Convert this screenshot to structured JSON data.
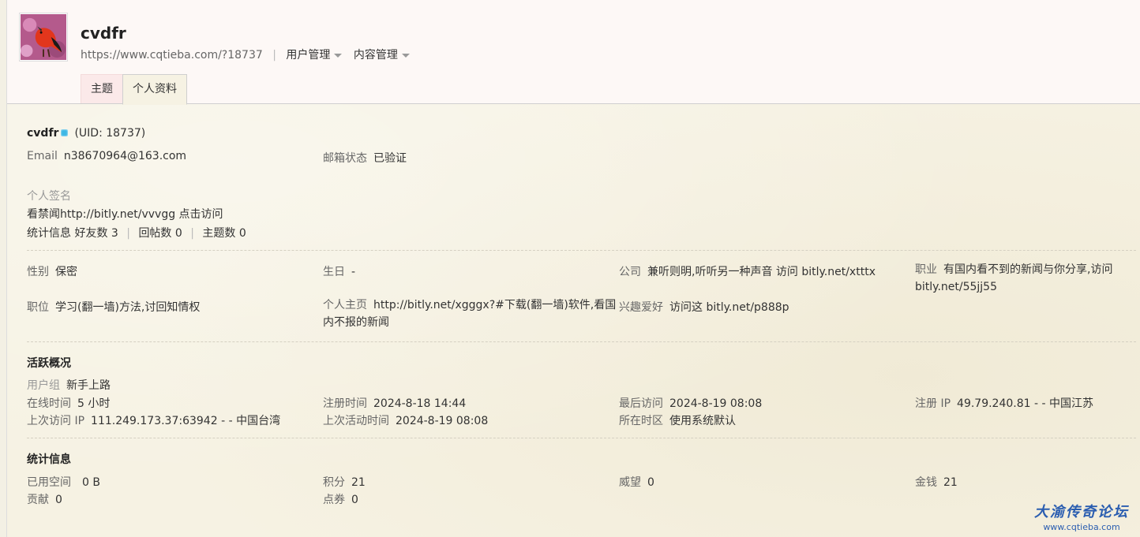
{
  "header": {
    "site_name": "cvdfr",
    "url": "https://www.cqtieba.com/?18737",
    "menus": [
      "用户管理",
      "内容管理"
    ],
    "tabs": [
      "主题",
      "个人资料"
    ]
  },
  "profile": {
    "username": "cvdfr",
    "uid": "(UID: 18737)",
    "email_label": "Email",
    "email": "n38670964@163.com",
    "email_status_label": "邮箱状态",
    "email_status": "已验证",
    "signature_label": "个人签名",
    "signature": "看禁闻http://bitly.net/vvvgg 点击访问",
    "stats_label": "统计信息",
    "stats": [
      "好友数 3",
      "回帖数 0",
      "主题数 0"
    ]
  },
  "details": {
    "gender_label": "性别",
    "gender": "保密",
    "birthday_label": "生日",
    "birthday": "-",
    "company_label": "公司",
    "company": "兼听则明,听听另一种声音 访问 bitly.net/xtttx",
    "occupation_label": "职业",
    "occupation": "有国内看不到的新闻与你分享,访问 bitly.net/55jj55",
    "position_label": "职位",
    "position": "学习(翻一墙)方法,讨回知情权",
    "homepage_label": "个人主页",
    "homepage": "http://bitly.net/xgggx?#下载(翻一墙)软件,看国内不报的新闻",
    "hobby_label": "兴趣爱好",
    "hobby": "访问这 bitly.net/p888p"
  },
  "activity": {
    "title": "活跃概况",
    "group_label": "用户组",
    "group": "新手上路",
    "online_label": "在线时间",
    "online": "5 小时",
    "reg_time_label": "注册时间",
    "reg_time": "2024-8-18 14:44",
    "last_visit_label": "最后访问",
    "last_visit": "2024-8-19 08:08",
    "reg_ip_label": "注册 IP",
    "reg_ip": "49.79.240.81 - - 中国江苏",
    "prev_ip_label": "上次访问 IP",
    "prev_ip": "111.249.173.37:63942 - - 中国台湾",
    "last_active_label": "上次活动时间",
    "last_active": "2024-8-19 08:08",
    "timezone_label": "所在时区",
    "timezone": "使用系统默认"
  },
  "statistics": {
    "title": "统计信息",
    "space_label": "已用空间",
    "space": "0 B",
    "points_label": "积分",
    "points": "21",
    "prestige_label": "威望",
    "prestige": "0",
    "money_label": "金钱",
    "money": "21",
    "contrib_label": "贡献",
    "contrib": "0",
    "coupon_label": "点券",
    "coupon": "0"
  },
  "watermark": {
    "main": "大渝传奇论坛",
    "sub": "www.cqtieba.com"
  },
  "colors": {
    "accent": "#2a5db0",
    "online": "#3db7e4",
    "tab_active_bg": "#fbe9e9"
  }
}
